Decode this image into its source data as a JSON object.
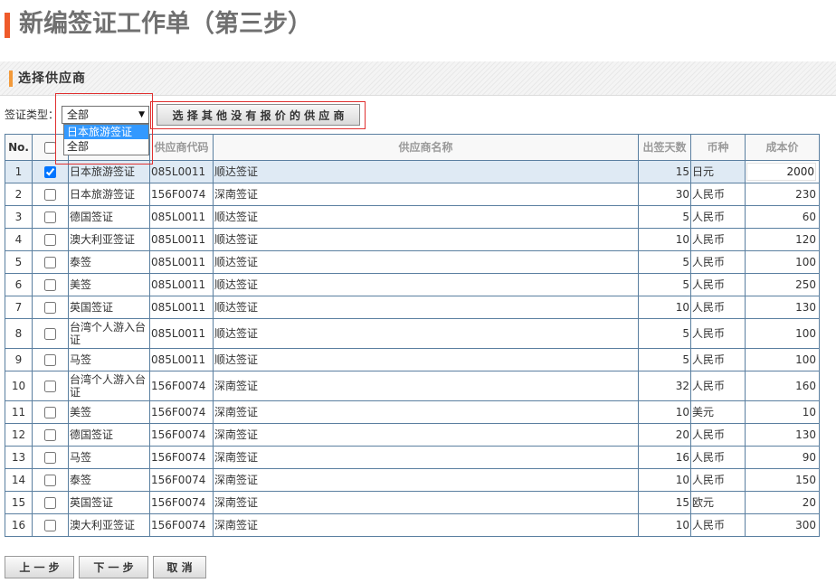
{
  "page": {
    "title": "新编签证工作单（第三步）"
  },
  "section": {
    "title": "选择供应商"
  },
  "filter": {
    "label": "签证类型：",
    "selected": "全部",
    "arrow": "▼",
    "options": [
      {
        "label": "日本旅游签证",
        "highlighted": true
      },
      {
        "label": "全部",
        "highlighted": false
      }
    ]
  },
  "actions": {
    "other_suppliers": "选 择 其 他 没 有 报 价 的 供 应 商"
  },
  "table": {
    "headers": {
      "no": "No.",
      "code": "供应商代码",
      "name": "供应商名称",
      "days": "出签天数",
      "currency": "币种",
      "cost": "成本价"
    },
    "rows": [
      {
        "no": 1,
        "checked": true,
        "type": "日本旅游签证",
        "code": "085L0011",
        "name": "顺达签证",
        "days": 15,
        "currency": "日元",
        "cost": 2000
      },
      {
        "no": 2,
        "checked": false,
        "type": "日本旅游签证",
        "code": "156F0074",
        "name": "深南签证",
        "days": 30,
        "currency": "人民币",
        "cost": 230
      },
      {
        "no": 3,
        "checked": false,
        "type": "德国签证",
        "code": "085L0011",
        "name": "顺达签证",
        "days": 5,
        "currency": "人民币",
        "cost": 60
      },
      {
        "no": 4,
        "checked": false,
        "type": "澳大利亚签证",
        "code": "085L0011",
        "name": "顺达签证",
        "days": 10,
        "currency": "人民币",
        "cost": 120
      },
      {
        "no": 5,
        "checked": false,
        "type": "泰签",
        "code": "085L0011",
        "name": "顺达签证",
        "days": 5,
        "currency": "人民币",
        "cost": 100
      },
      {
        "no": 6,
        "checked": false,
        "type": "美签",
        "code": "085L0011",
        "name": "顺达签证",
        "days": 5,
        "currency": "人民币",
        "cost": 250
      },
      {
        "no": 7,
        "checked": false,
        "type": "英国签证",
        "code": "085L0011",
        "name": "顺达签证",
        "days": 10,
        "currency": "人民币",
        "cost": 130
      },
      {
        "no": 8,
        "checked": false,
        "type": "台湾个人游入台证",
        "code": "085L0011",
        "name": "顺达签证",
        "days": 5,
        "currency": "人民币",
        "cost": 100
      },
      {
        "no": 9,
        "checked": false,
        "type": "马签",
        "code": "085L0011",
        "name": "顺达签证",
        "days": 5,
        "currency": "人民币",
        "cost": 100
      },
      {
        "no": 10,
        "checked": false,
        "type": "台湾个人游入台证",
        "code": "156F0074",
        "name": "深南签证",
        "days": 32,
        "currency": "人民币",
        "cost": 160
      },
      {
        "no": 11,
        "checked": false,
        "type": "美签",
        "code": "156F0074",
        "name": "深南签证",
        "days": 10,
        "currency": "美元",
        "cost": 10
      },
      {
        "no": 12,
        "checked": false,
        "type": "德国签证",
        "code": "156F0074",
        "name": "深南签证",
        "days": 20,
        "currency": "人民币",
        "cost": 130
      },
      {
        "no": 13,
        "checked": false,
        "type": "马签",
        "code": "156F0074",
        "name": "深南签证",
        "days": 16,
        "currency": "人民币",
        "cost": 90
      },
      {
        "no": 14,
        "checked": false,
        "type": "泰签",
        "code": "156F0074",
        "name": "深南签证",
        "days": 10,
        "currency": "人民币",
        "cost": 150
      },
      {
        "no": 15,
        "checked": false,
        "type": "英国签证",
        "code": "156F0074",
        "name": "深南签证",
        "days": 15,
        "currency": "欧元",
        "cost": 20
      },
      {
        "no": 16,
        "checked": false,
        "type": "澳大利亚签证",
        "code": "156F0074",
        "name": "深南签证",
        "days": 10,
        "currency": "人民币",
        "cost": 300
      }
    ]
  },
  "footer": {
    "prev": "上 一 步",
    "next": "下 一 步",
    "cancel": "取 消"
  },
  "colors": {
    "title_accent": "#ef5a2a",
    "section_accent": "#f39a3a",
    "option_highlight": "#3399ff",
    "row_highlight": "#dfeaf4",
    "grid_border": "#5a7fa0",
    "annotation_box": "#e03030"
  }
}
